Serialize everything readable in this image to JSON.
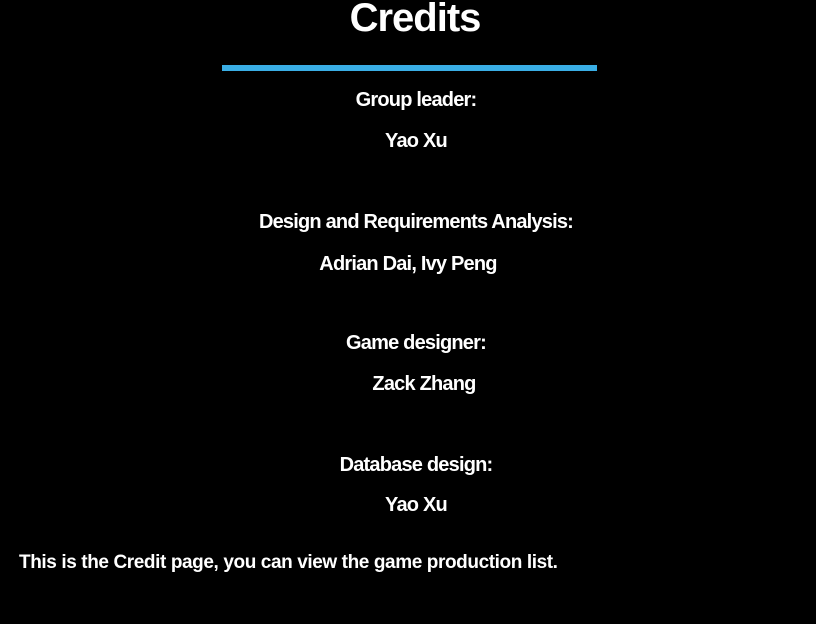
{
  "screen": {
    "title": "Credits",
    "accent_color": "#3aaee5",
    "background_color": "#000000"
  },
  "credits": [
    {
      "role": "Group leader:",
      "names": "Yao Xu"
    },
    {
      "role": "Design and Requirements Analysis:",
      "names": "Adrian Dai, Ivy Peng"
    },
    {
      "role": "Game designer:",
      "names": "Zack Zhang"
    },
    {
      "role": "Database design:",
      "names": "Yao Xu"
    }
  ],
  "caption": "This is the Credit page, you can view the game production list."
}
